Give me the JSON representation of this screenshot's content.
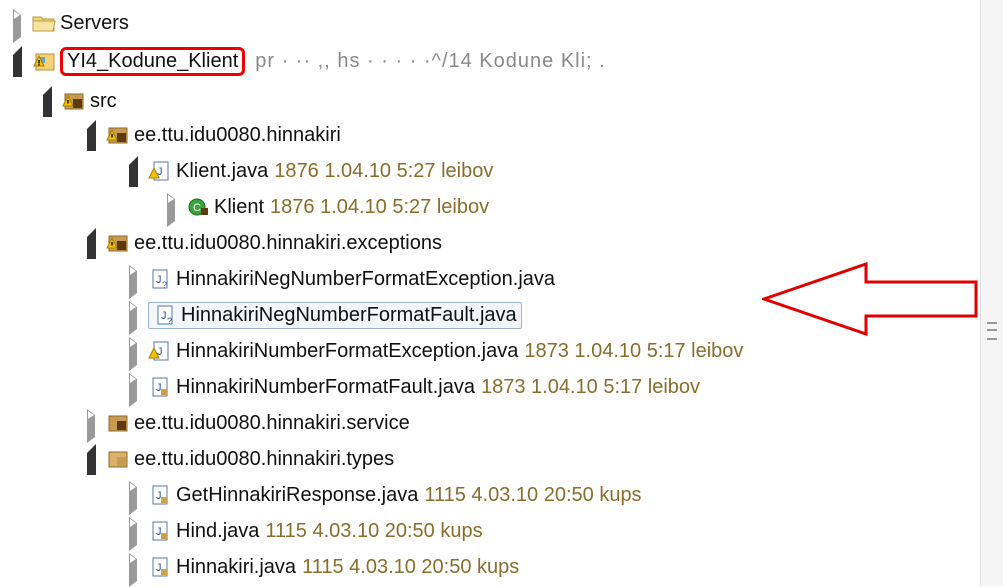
{
  "tree": {
    "servers": {
      "label": "Servers",
      "icon": "folder-icon"
    },
    "project": {
      "label": "YI4_Kodune_Klient",
      "faint_text": "pr    ·  ··   ,,       hs          ·         ·  ·   ·  ·^/14  Kodune Kli;   ."
    },
    "src": {
      "label": "src"
    },
    "pkg1": {
      "label": "ee.ttu.idu0080.hinnakiri"
    },
    "klient_java": {
      "label": "Klient.java",
      "dec": "1876  1.04.10 5:27  leibov"
    },
    "klient_class": {
      "label": "Klient",
      "dec": "1876  1.04.10 5:27  leibov"
    },
    "pkg2": {
      "label": "ee.ttu.idu0080.hinnakiri.exceptions"
    },
    "file1": {
      "label": "HinnakiriNegNumberFormatException.java"
    },
    "file2": {
      "label": "HinnakiriNegNumberFormatFault.java"
    },
    "file3": {
      "label": "HinnakiriNumberFormatException.java",
      "dec": "1873  1.04.10 5:17  leibov"
    },
    "file4": {
      "label": "HinnakiriNumberFormatFault.java",
      "dec": "1873  1.04.10 5:17  leibov"
    },
    "pkg3": {
      "label": "ee.ttu.idu0080.hinnakiri.service"
    },
    "pkg4": {
      "label": "ee.ttu.idu0080.hinnakiri.types"
    },
    "file5": {
      "label": "GetHinnakiriResponse.java",
      "dec": "1115  4.03.10 20:50  kups"
    },
    "file6": {
      "label": "Hind.java",
      "dec": "1115  4.03.10 20:50  kups"
    },
    "file7": {
      "label": "Hinnakiri.java",
      "dec": "1115  4.03.10 20:50  kups"
    }
  },
  "colors": {
    "highlight_red": "#e00000",
    "decoration": "#8a6d2a"
  }
}
